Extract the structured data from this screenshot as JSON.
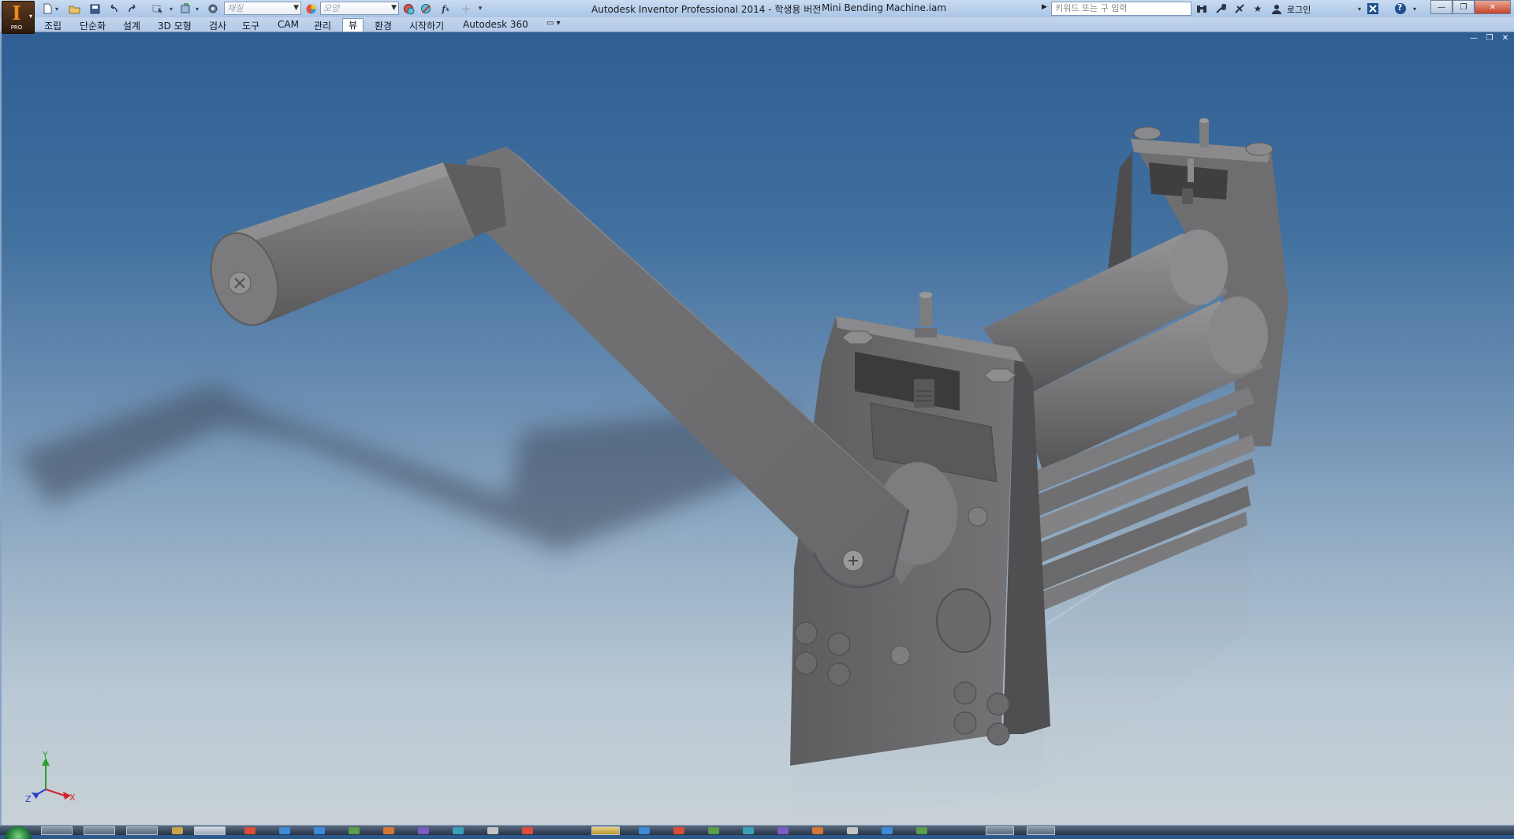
{
  "window": {
    "title": "Autodesk Inventor Professional 2014 - 학생용 버전",
    "filename": "Mini Bending Machine.iam"
  },
  "app_button": {
    "letter": "I",
    "edition": "PRO"
  },
  "quick_access": {
    "material_placeholder": "재질",
    "appearance_placeholder": "모양",
    "formula_symbol": "f",
    "formula_subscript": "x"
  },
  "search": {
    "placeholder": "키워드 또는 구 입력"
  },
  "account": {
    "login_label": "로그인",
    "help_symbol": "?"
  },
  "ribbon_tabs": [
    {
      "label": "조립",
      "active": false
    },
    {
      "label": "단순화",
      "active": false
    },
    {
      "label": "설계",
      "active": false
    },
    {
      "label": "3D 모형",
      "active": false
    },
    {
      "label": "검사",
      "active": false
    },
    {
      "label": "도구",
      "active": false
    },
    {
      "label": "CAM",
      "active": false
    },
    {
      "label": "관리",
      "active": false
    },
    {
      "label": "뷰",
      "active": true
    },
    {
      "label": "환경",
      "active": false
    },
    {
      "label": "시작하기",
      "active": false
    },
    {
      "label": "Autodesk 360",
      "active": false
    }
  ],
  "viewport": {
    "model": "Mini Bending Machine",
    "triad": {
      "x_label": "X",
      "y_label": "Y",
      "z_label": "Z"
    }
  },
  "colors": {
    "x_axis": "#d2232a",
    "y_axis": "#2aa02a",
    "z_axis": "#2540c8",
    "part_gray": "#7f7f80",
    "active_tab": "#fdfdfd"
  }
}
